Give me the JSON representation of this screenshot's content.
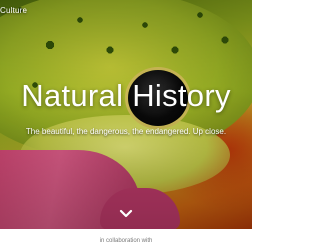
{
  "header": {
    "brand": "Culture"
  },
  "hero": {
    "title": "Natural History",
    "subtitle": "The beautiful, the dangerous, the endangered. Up close."
  },
  "scroll_icon": "chevron-down-icon",
  "footer": {
    "collab_text": "in collaboration with"
  },
  "colors": {
    "hero_text": "#ffffff",
    "collab_text": "#7a7a7a",
    "background": "#ffffff"
  }
}
